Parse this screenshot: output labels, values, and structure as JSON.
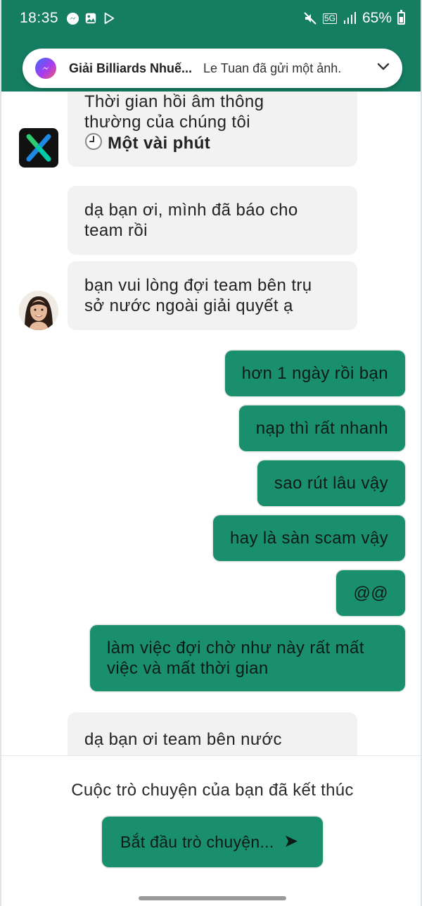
{
  "status_bar": {
    "time": "18:35",
    "network": "5G",
    "battery": "65%"
  },
  "notification": {
    "app_icon": "messenger-icon",
    "title": "Giải Billiards Nhuế...",
    "message": "Le Tuan đã gửi một ảnh."
  },
  "chat": {
    "reply_time_card": {
      "line1": "Thời gian hồi âm thông",
      "line2": "thường của chúng tôi",
      "time": "Một vài phút"
    },
    "incoming_1": {
      "line1": "dạ bạn ơi, mình đã báo cho",
      "line2": "team rồi"
    },
    "incoming_2": {
      "line1": "bạn vui lòng đợi team bên trụ",
      "line2": "sở nước ngoài giải quyết ạ"
    },
    "outgoing": [
      "hơn 1 ngày rồi bạn",
      "nạp thì rất nhanh",
      "sao rút lâu vậy",
      "hay là sàn scam vậy",
      "@@"
    ],
    "outgoing_long": {
      "line1": "làm việc đợi chờ như này rất mất",
      "line2": "việc và mất thời gian"
    },
    "incoming_3": {
      "line1": "dạ bạn ơi team bên nước"
    }
  },
  "footer": {
    "ended_text": "Cuộc trò chuyện của bạn đã kết thúc",
    "start_button": "Bắt đầu trò chuyện..."
  },
  "colors": {
    "header": "#157e62",
    "accent": "#1a8f6e",
    "incoming_bubble": "#f2f2f2"
  }
}
